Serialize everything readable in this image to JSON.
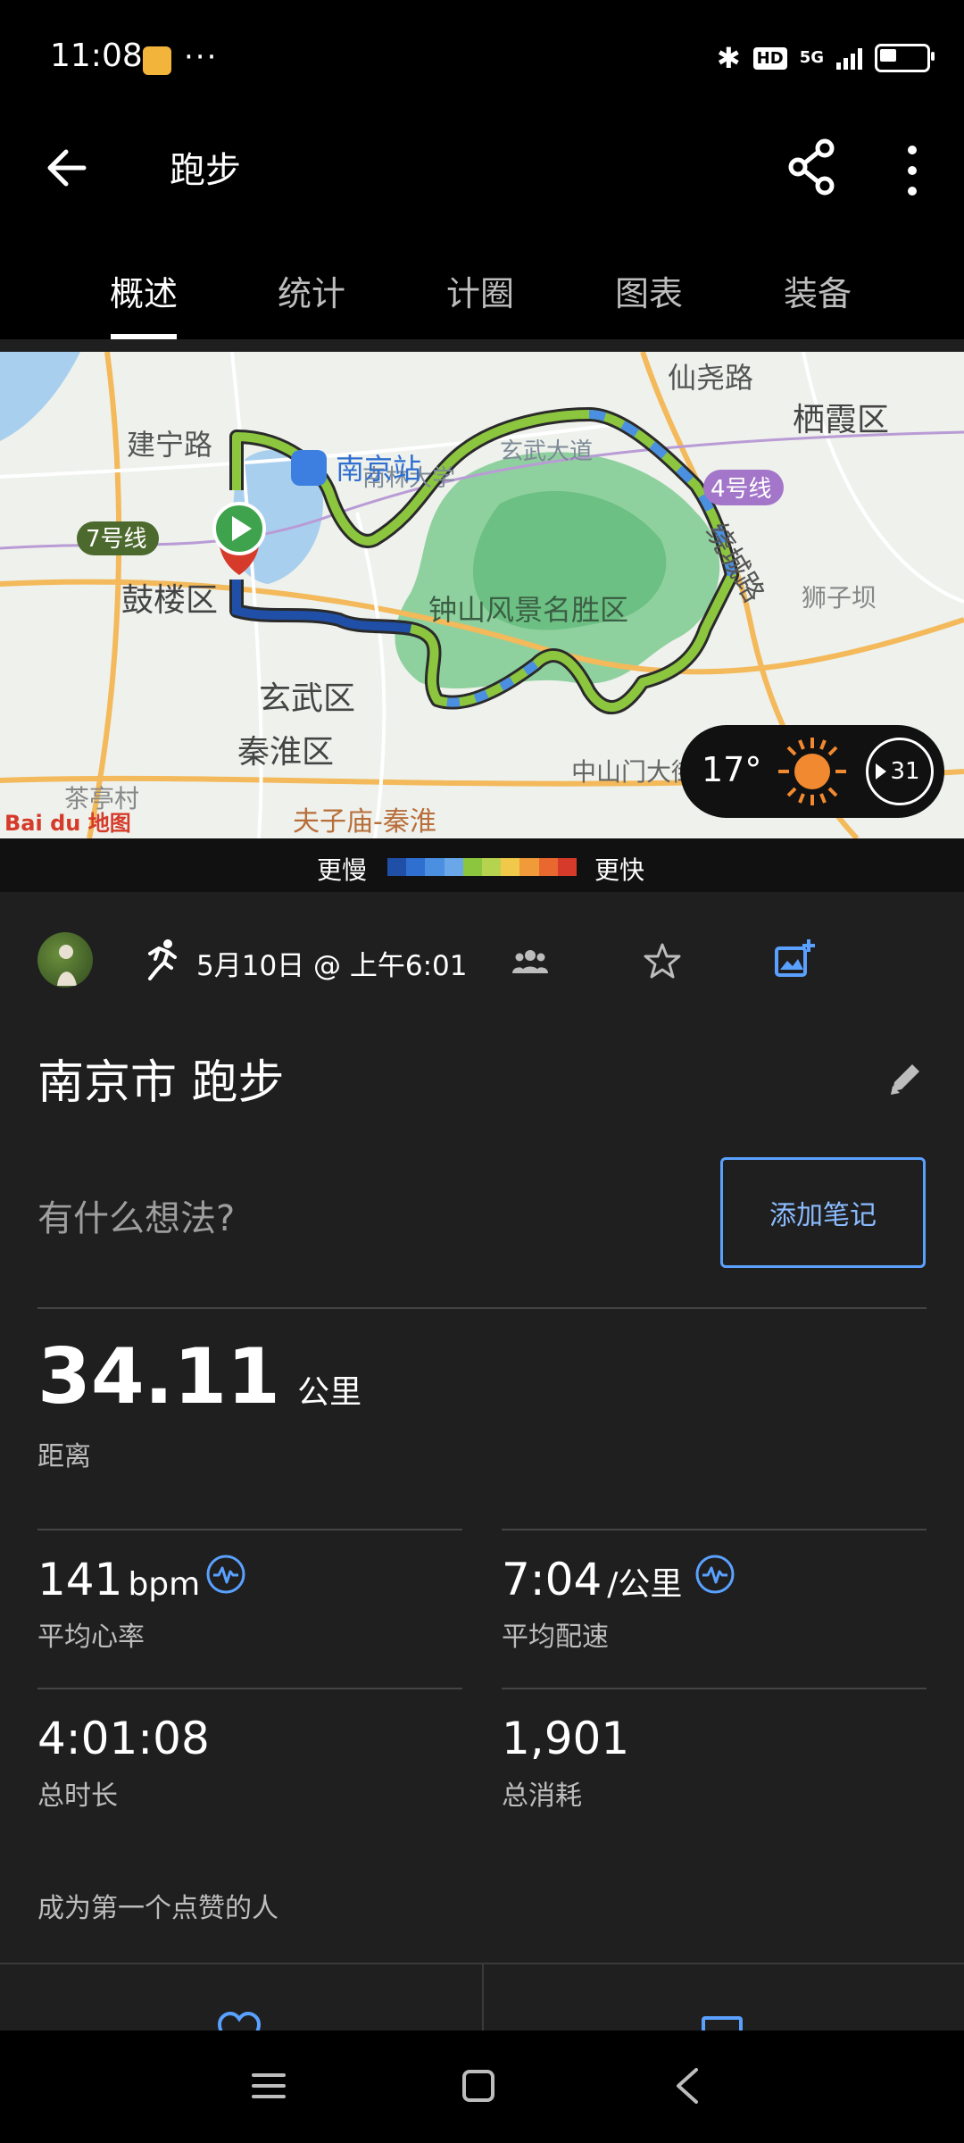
{
  "status_bar": {
    "time": "11:08",
    "dots": "···",
    "hd": "HD",
    "network": "5G",
    "battery_level": 0.35
  },
  "app_bar": {
    "title": "跑步",
    "icons": [
      "arrow-back-icon",
      "share-icon",
      "more-vert-icon"
    ]
  },
  "tabs": [
    {
      "label": "概述",
      "active": true
    },
    {
      "label": "统计",
      "active": false
    },
    {
      "label": "计圈",
      "active": false
    },
    {
      "label": "图表",
      "active": false
    },
    {
      "label": "装备",
      "active": false
    }
  ],
  "map": {
    "labels": {
      "xianyao_rd": "仙尧路",
      "jianning_rd": "建宁路",
      "nanjing_station": "南京站",
      "qixia": "栖霞区",
      "line4": "4号线",
      "line7": "7号线",
      "raocheng_rd": "绕城路",
      "gulou": "鼓楼区",
      "nanlin": "南林大学",
      "zhongshan": "钟山风景名胜区",
      "shizikan": "狮子坝",
      "xuanwu": "玄武区",
      "qinhuai": "秦淮区",
      "chating": "茶亭村",
      "zhongshanmen": "中山门大街",
      "fuzimiao": "夫子庙-秦淮",
      "xuanwu_lake_rd": "玄武大道",
      "baidu_logo": "Bai du 地图"
    },
    "weather": {
      "temperature": "17°",
      "icon": "sun-icon",
      "badge_value": "31"
    }
  },
  "legend": {
    "slower": "更慢",
    "faster": "更快",
    "colors": [
      "#1f4fa6",
      "#2e6fd0",
      "#4b8fe0",
      "#6aa7e8",
      "#8cc63f",
      "#b6d350",
      "#f0c94a",
      "#f09a3a",
      "#e8682f",
      "#d63a2a"
    ]
  },
  "activity": {
    "date": "5月10日 @ 上午6:01",
    "title": "南京市 跑步",
    "note_placeholder": "有什么想法?",
    "add_note": "添加笔记",
    "distance": {
      "value": "34.11",
      "unit": "公里",
      "label": "距离"
    },
    "heart_rate": {
      "value": "141",
      "unit": "bpm",
      "label": "平均心率"
    },
    "pace": {
      "value": "7:04",
      "unit": "/公里",
      "label": "平均配速"
    },
    "duration": {
      "value": "4:01:08",
      "label": "总时长"
    },
    "calories": {
      "value": "1,901",
      "label": "总消耗"
    },
    "likes_text": "成为第一个点赞的人"
  },
  "accent": "#5aa1ff"
}
